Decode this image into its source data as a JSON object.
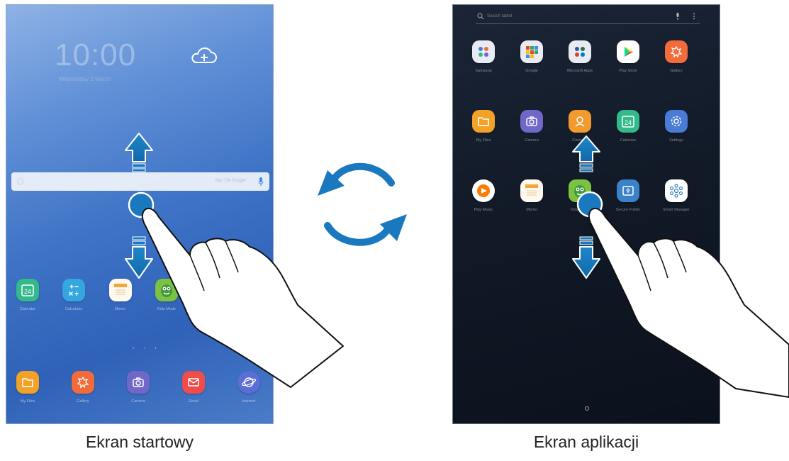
{
  "home_screen": {
    "clock_time": "10:00",
    "clock_date": "Wednesday 2 March",
    "search_hint": "Say \"Ok Google\"",
    "favorites": [
      {
        "label": "Calendar",
        "icon": "calendar-icon",
        "color": "#33b98a"
      },
      {
        "label": "Calculator",
        "icon": "calculator-icon",
        "color": "#35a7df"
      },
      {
        "label": "Memo",
        "icon": "memo-icon",
        "color": "#f3a63a"
      },
      {
        "label": "Kids Mode",
        "icon": "kids-mode-icon",
        "color": "#7cc242"
      }
    ],
    "dock": [
      {
        "label": "My Files",
        "icon": "folder-icon",
        "color": "#f2a227"
      },
      {
        "label": "Gallery",
        "icon": "gallery-icon",
        "color": "#f26b3a"
      },
      {
        "label": "Camera",
        "icon": "camera-icon",
        "color": "#6f68c9"
      },
      {
        "label": "Email",
        "icon": "email-icon",
        "color": "#ef4c4c"
      },
      {
        "label": "Internet",
        "icon": "internet-icon",
        "color": "#5b6dd6"
      }
    ]
  },
  "apps_screen": {
    "search_hint": "Search tablet",
    "apps": [
      {
        "label": "Samsung",
        "icon": "samsung-folder-icon",
        "color": "#e8ecf2"
      },
      {
        "label": "Google",
        "icon": "google-folder-icon",
        "color": "#e8ecf2"
      },
      {
        "label": "Microsoft Apps",
        "icon": "microsoft-folder-icon",
        "color": "#e8ecf2"
      },
      {
        "label": "Play Store",
        "icon": "play-store-icon",
        "color": "#ffffff"
      },
      {
        "label": "Gallery",
        "icon": "gallery-icon",
        "color": "#f26b3a"
      },
      {
        "label": "My Files",
        "icon": "folder-icon",
        "color": "#f2a227"
      },
      {
        "label": "Camera",
        "icon": "camera-icon",
        "color": "#6f68c9"
      },
      {
        "label": "Contacts",
        "icon": "contacts-icon",
        "color": "#f29a2e"
      },
      {
        "label": "Calendar",
        "icon": "calendar-icon",
        "color": "#33b98a"
      },
      {
        "label": "Settings",
        "icon": "settings-icon",
        "color": "#4a7bd6"
      },
      {
        "label": "Play Music",
        "icon": "play-music-icon",
        "color": "#ffffff"
      },
      {
        "label": "Memo",
        "icon": "memo-icon",
        "color": "#f3a63a"
      },
      {
        "label": "Kids Mode",
        "icon": "kids-mode-icon",
        "color": "#7cc242"
      },
      {
        "label": "Secure Folder",
        "icon": "secure-folder-icon",
        "color": "#3b82c9"
      },
      {
        "label": "Smart Manager",
        "icon": "smart-manager-icon",
        "color": "#ffffff"
      }
    ]
  },
  "captions": {
    "home": "Ekran startowy",
    "apps": "Ekran aplikacji"
  },
  "accent_color": "#1a78be"
}
